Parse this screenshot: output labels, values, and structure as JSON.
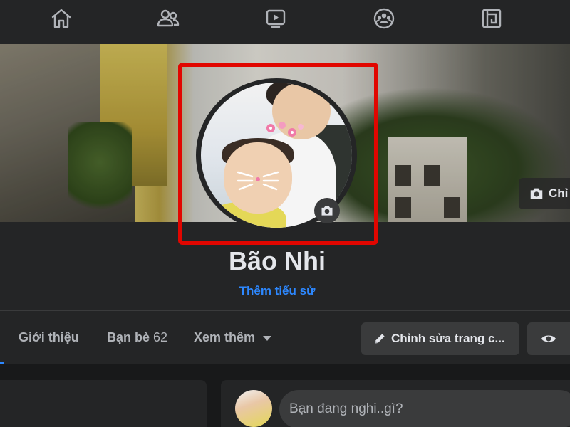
{
  "nav": {
    "items": [
      {
        "icon": "home-icon"
      },
      {
        "icon": "friends-icon"
      },
      {
        "icon": "watch-icon"
      },
      {
        "icon": "groups-icon"
      },
      {
        "icon": "gaming-icon"
      }
    ]
  },
  "cover": {
    "edit_label": "Chỉ"
  },
  "profile": {
    "name": "Bão Nhi",
    "bio_link": "Thêm tiểu sử"
  },
  "tabs": {
    "about": "Giới thiệu",
    "friends": "Bạn bè",
    "friends_count": "62",
    "more": "Xem thêm"
  },
  "actions": {
    "edit_profile": "Chỉnh sửa trang c..."
  },
  "composer": {
    "placeholder": "Bạn đang nghi..gì?"
  },
  "colors": {
    "highlight": "#e10600",
    "link": "#2d88ff",
    "background": "#18191a",
    "surface": "#242526"
  }
}
